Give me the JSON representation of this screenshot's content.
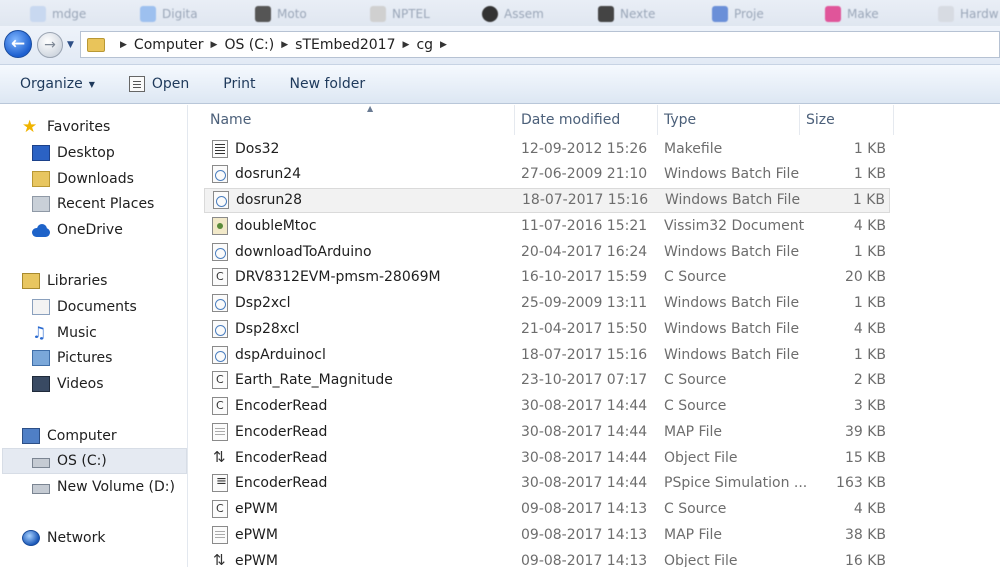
{
  "tabs_strip": [
    "mdge",
    "Digita",
    "Moto",
    "NPTEL",
    "Assem",
    "Nexte",
    "Proje",
    "Make",
    "Hardw"
  ],
  "address": {
    "crumbs": [
      "Computer",
      "OS (C:)",
      "sTEmbed2017",
      "cg"
    ]
  },
  "toolbar": {
    "organize": "Organize",
    "open": "Open",
    "print": "Print",
    "new_folder": "New folder"
  },
  "nav": {
    "favorites": "Favorites",
    "desktop": "Desktop",
    "downloads": "Downloads",
    "recent": "Recent Places",
    "onedrive": "OneDrive",
    "libraries": "Libraries",
    "documents": "Documents",
    "music": "Music",
    "pictures": "Pictures",
    "videos": "Videos",
    "computer": "Computer",
    "os_c": "OS (C:)",
    "new_volume": "New Volume (D:)",
    "network": "Network"
  },
  "columns": {
    "name": "Name",
    "date": "Date modified",
    "type": "Type",
    "size": "Size"
  },
  "files": [
    {
      "name": "Dos32",
      "date": "12-09-2012 15:26",
      "type": "Makefile",
      "size": "1 KB",
      "icon": "make"
    },
    {
      "name": "dosrun24",
      "date": "27-06-2009 21:10",
      "type": "Windows Batch File",
      "size": "1 KB",
      "icon": "bat"
    },
    {
      "name": "dosrun28",
      "date": "18-07-2017 15:16",
      "type": "Windows Batch File",
      "size": "1 KB",
      "icon": "bat"
    },
    {
      "name": "doubleMtoc",
      "date": "11-07-2016 15:21",
      "type": "Vissim32 Document",
      "size": "4 KB",
      "icon": "vsm"
    },
    {
      "name": "downloadToArduino",
      "date": "20-04-2017 16:24",
      "type": "Windows Batch File",
      "size": "1 KB",
      "icon": "bat"
    },
    {
      "name": "DRV8312EVM-pmsm-28069M",
      "date": "16-10-2017 15:59",
      "type": "C Source",
      "size": "20 KB",
      "icon": "csrc"
    },
    {
      "name": "Dsp2xcl",
      "date": "25-09-2009 13:11",
      "type": "Windows Batch File",
      "size": "1 KB",
      "icon": "bat"
    },
    {
      "name": "Dsp28xcl",
      "date": "21-04-2017 15:50",
      "type": "Windows Batch File",
      "size": "4 KB",
      "icon": "bat"
    },
    {
      "name": "dspArduinocl",
      "date": "18-07-2017 15:16",
      "type": "Windows Batch File",
      "size": "1 KB",
      "icon": "bat"
    },
    {
      "name": "Earth_Rate_Magnitude",
      "date": "23-10-2017 07:17",
      "type": "C Source",
      "size": "2 KB",
      "icon": "csrc"
    },
    {
      "name": "EncoderRead",
      "date": "30-08-2017 14:44",
      "type": "C Source",
      "size": "3 KB",
      "icon": "csrc"
    },
    {
      "name": "EncoderRead",
      "date": "30-08-2017 14:44",
      "type": "MAP File",
      "size": "39 KB",
      "icon": "map"
    },
    {
      "name": "EncoderRead",
      "date": "30-08-2017 14:44",
      "type": "Object File",
      "size": "15 KB",
      "icon": "obj"
    },
    {
      "name": "EncoderRead",
      "date": "30-08-2017 14:44",
      "type": "PSpice Simulation ...",
      "size": "163 KB",
      "icon": "psp"
    },
    {
      "name": "ePWM",
      "date": "09-08-2017 14:13",
      "type": "C Source",
      "size": "4 KB",
      "icon": "csrc"
    },
    {
      "name": "ePWM",
      "date": "09-08-2017 14:13",
      "type": "MAP File",
      "size": "38 KB",
      "icon": "map"
    },
    {
      "name": "ePWM",
      "date": "09-08-2017 14:13",
      "type": "Object File",
      "size": "16 KB",
      "icon": "obj"
    }
  ]
}
